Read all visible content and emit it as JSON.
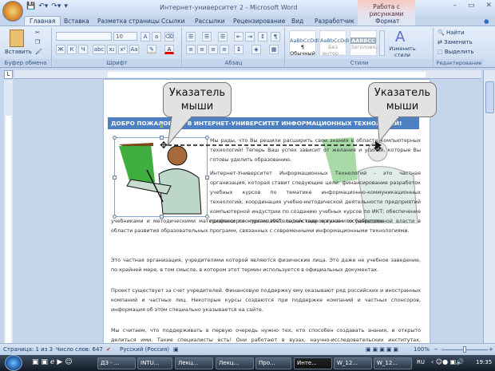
{
  "window": {
    "title": "Интернет-университет 2 - Microsoft Word",
    "context_tab": "Работа с рисунками",
    "minimize": "–",
    "maximize": "▭",
    "close": "✕"
  },
  "tabs": [
    "Главная",
    "Вставка",
    "Разметка страницы",
    "Ссылки",
    "Рассылки",
    "Рецензирование",
    "Вид",
    "Разработчик",
    "Формат"
  ],
  "ribbon": {
    "clipboard": {
      "label": "Буфер обмена",
      "paste": "Вставить"
    },
    "font": {
      "label": "Шрифт",
      "font_name": "",
      "font_size": "10",
      "buttons": [
        "Ж",
        "К",
        "Ч",
        "abc",
        "x₂",
        "x²",
        "Aa"
      ]
    },
    "paragraph": {
      "label": "Абзац"
    },
    "styles": {
      "label": "Стили",
      "items": [
        {
          "preview": "AaBbCcDdI",
          "name": "¶ Обычный"
        },
        {
          "preview": "AaBbCcDdI",
          "name": "Без интер..."
        },
        {
          "preview": "AABBCC",
          "name": "Заголово..."
        }
      ],
      "change": "Изменить стили"
    },
    "editing": {
      "label": "Редактирование",
      "find": "Найти",
      "replace": "Заменить",
      "select": "Выделить"
    }
  },
  "document": {
    "banner": "ДОБРО ПОЖАЛОВАТЬ В ИНТЕРНЕТ-УНИВЕРСИТЕТ ИНФОРМАЦИОННЫХ ТЕХНОЛОГИЙ!",
    "paragraphs": [
      "Мы рады, что Вы решили расширить свои знания в области компьютерных технологий! Теперь Ваш успех зависит от желания и усилий, которые Вы готовы уделить образованию.",
      "Интернет-Университет Информационных Технологий - это частная организация, которая ставит следующие цели: финансирование разработок учебных курсов по тематике информационно-коммуникационных технологий; координация учебно-методической деятельности предприятий компьютерной индустрии по созданию учебных курсов по ИКТ; обеспечение профессорско-преподавательских кадров вузов и их библиотек",
      "учебниками и методическими материалами по курсам ИКТ; содействие органам государственной власти в области развития образовательных программ, связанных с современными информационными технологиями.",
      "Это частная организация, учредителями которой являются физические лица. Это даже не учебное заведение, по крайней мере, в том смысле, в котором этот термин используется в официальных документах.",
      "Проект существует за счет учредителей. Финансовую поддержку ему оказывают ряд российских и иностранных компаний и частных лиц. Некоторые курсы создаются при поддержке компаний и частных спонсоров, информация об этом специально указывается на сайте.",
      "Мы считаем, что поддерживать в первую очередь нужно тех, кто способен создавать знания, и открыто делиться ими. Такие специалисты есть! Они работают в вузах, научно-исследовательских институтах, государственных и коммерческих компаниях. Мы знаем многих, кто способен создать для системы"
    ],
    "callouts": [
      "Указатель мыши",
      "Указатель мыши"
    ]
  },
  "status": {
    "page": "Страница: 1 из 3",
    "words": "Число слов: 647",
    "language": "Русский (Россия)",
    "zoom": "100%",
    "zoom_minus": "−",
    "zoom_plus": "+"
  },
  "taskbar": {
    "items": [
      "ДЗ - ...",
      "INTU...",
      "Лекц...",
      "Лекц...",
      "Про...",
      "Инте...",
      "W_12...",
      "W_12..."
    ],
    "active_index": 5,
    "lang": "RU",
    "clock": "19:35"
  },
  "colors": {
    "banner": "#4d7fc1",
    "ribbon": "#d3e1f3",
    "taskbar": "#1e2a38"
  }
}
